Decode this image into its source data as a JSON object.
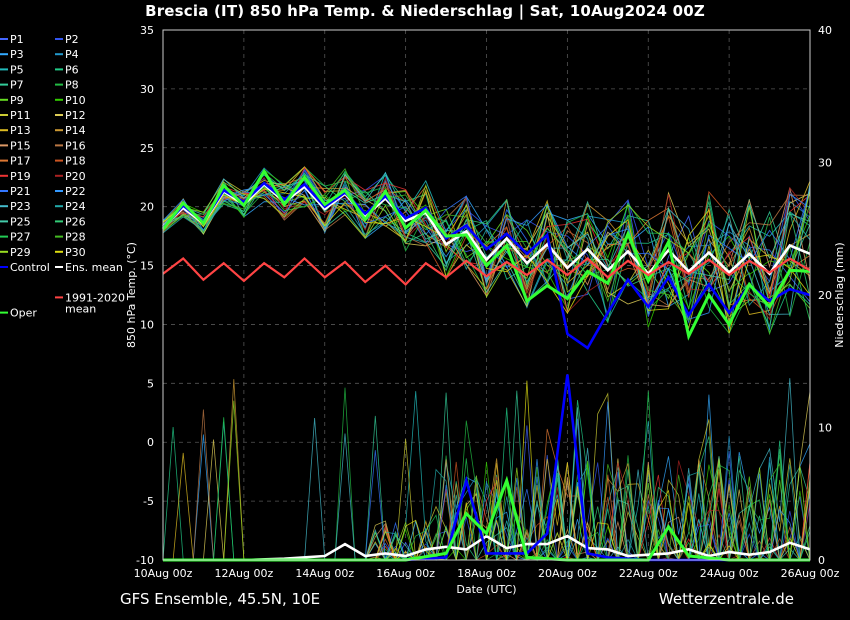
{
  "title": "Brescia  (IT)  850 hPa Temp. & Niederschlag | Sat, 10Aug2024 00Z",
  "footer_left": "GFS Ensemble, 45.5N, 10E",
  "footer_right": "Wetterzentrale.de",
  "chart_data": {
    "type": "line",
    "xlabel": "Date (UTC)",
    "ylabel_left": "850 hPa Temp. (°C)",
    "ylabel_right": "Niederschlag (mm)",
    "x_ticks": [
      "10Aug 00z",
      "12Aug 00z",
      "14Aug 00z",
      "16Aug 00z",
      "18Aug 00z",
      "20Aug 00z",
      "22Aug 00z",
      "24Aug 00z",
      "26Aug 00z"
    ],
    "xlim_days": [
      0,
      16
    ],
    "ylim_left": [
      -10,
      35
    ],
    "yticks_left": [
      -10,
      -5,
      0,
      5,
      10,
      15,
      20,
      25,
      30,
      35
    ],
    "ylim_right": [
      0,
      40
    ],
    "yticks_right": [
      0,
      10,
      20,
      30,
      40
    ],
    "grid": true,
    "legend_placement": "left",
    "legend": [
      {
        "label": "P1",
        "color": "#4466ff"
      },
      {
        "label": "P2",
        "color": "#3355ee"
      },
      {
        "label": "P3",
        "color": "#33aaff"
      },
      {
        "label": "P4",
        "color": "#2299cc"
      },
      {
        "label": "P5",
        "color": "#22bbbb"
      },
      {
        "label": "P6",
        "color": "#22cc88"
      },
      {
        "label": "P7",
        "color": "#33cc99"
      },
      {
        "label": "P8",
        "color": "#22bb44"
      },
      {
        "label": "P9",
        "color": "#66dd22"
      },
      {
        "label": "P10",
        "color": "#33cc00"
      },
      {
        "label": "P11",
        "color": "#cccc33"
      },
      {
        "label": "P12",
        "color": "#ddcc55"
      },
      {
        "label": "P13",
        "color": "#ddbb22"
      },
      {
        "label": "P14",
        "color": "#cc9933"
      },
      {
        "label": "P15",
        "color": "#dd9966"
      },
      {
        "label": "P16",
        "color": "#bb7744"
      },
      {
        "label": "P17",
        "color": "#dd7733"
      },
      {
        "label": "P18",
        "color": "#cc5522"
      },
      {
        "label": "P19",
        "color": "#ee3333"
      },
      {
        "label": "P20",
        "color": "#aa2222"
      },
      {
        "label": "P21",
        "color": "#3377ff"
      },
      {
        "label": "P22",
        "color": "#3399ff"
      },
      {
        "label": "P23",
        "color": "#44bbcc"
      },
      {
        "label": "P24",
        "color": "#22aaaa"
      },
      {
        "label": "P25",
        "color": "#44ccaa"
      },
      {
        "label": "P26",
        "color": "#33cc77"
      },
      {
        "label": "P27",
        "color": "#22cc55"
      },
      {
        "label": "P28",
        "color": "#44bb22"
      },
      {
        "label": "P29",
        "color": "#99dd22"
      },
      {
        "label": "P30",
        "color": "#dddd11"
      },
      {
        "label": "Control",
        "color": "#0000ff"
      },
      {
        "label": "Ens. mean",
        "color": "#ffffff"
      },
      {
        "label": "1991-2020 mean",
        "color": "#ff4444"
      },
      {
        "label": "Oper",
        "color": "#33ff33"
      }
    ],
    "series_temp": [
      {
        "name": "Ens. mean",
        "color": "#ffffff",
        "x": [
          0,
          0.5,
          1,
          1.5,
          2,
          2.5,
          3,
          3.5,
          4,
          4.5,
          5,
          5.5,
          6,
          6.5,
          7,
          7.5,
          8,
          8.5,
          9,
          9.5,
          10,
          10.5,
          11,
          11.5,
          12,
          12.5,
          13,
          13.5,
          14,
          14.5,
          15,
          15.5,
          16
        ],
        "y": [
          18.3,
          19.9,
          18.6,
          21.3,
          20.2,
          21.9,
          20.4,
          21.7,
          19.8,
          21.1,
          19.2,
          20.7,
          18.8,
          19.5,
          16.8,
          17.9,
          15.5,
          17.3,
          15.2,
          16.8,
          14.8,
          16.4,
          14.6,
          16.2,
          14.3,
          16.3,
          14.5,
          16.1,
          14.4,
          16.0,
          14.3,
          16.7,
          16.0
        ]
      },
      {
        "name": "Control",
        "color": "#0000ff",
        "x": [
          0,
          0.5,
          1,
          1.5,
          2,
          2.5,
          3,
          3.5,
          4,
          4.5,
          5,
          5.5,
          6,
          6.5,
          7,
          7.5,
          8,
          8.5,
          9,
          9.5,
          10,
          10.5,
          11,
          11.5,
          12,
          12.5,
          13,
          13.5,
          14,
          14.5,
          15,
          15.5,
          16
        ],
        "y": [
          18.2,
          20.1,
          18.7,
          21.4,
          20.4,
          22.0,
          20.6,
          21.9,
          20.0,
          21.2,
          19.4,
          20.9,
          19.0,
          19.9,
          17.3,
          18.4,
          16.4,
          17.7,
          16.0,
          17.6,
          9.2,
          8.0,
          11.0,
          13.8,
          11.5,
          14.0,
          10.8,
          13.4,
          11.0,
          13.3,
          12.0,
          13.0,
          12.5
        ]
      },
      {
        "name": "Oper",
        "color": "#33ff33",
        "x": [
          0,
          0.5,
          1,
          1.5,
          2,
          2.5,
          3,
          3.5,
          4,
          4.5,
          5,
          5.5,
          6,
          6.5,
          7,
          7.5,
          8,
          8.5,
          9,
          9.5,
          10,
          10.5,
          11,
          11.5,
          12,
          12.5,
          13,
          13.5,
          14,
          14.5,
          15,
          15.5,
          16
        ],
        "y": [
          18.1,
          20.3,
          18.6,
          21.8,
          20.1,
          23.0,
          20.2,
          22.5,
          20.2,
          21.4,
          18.9,
          21.3,
          18.2,
          19.7,
          17.5,
          17.6,
          15.0,
          16.7,
          12.0,
          13.3,
          12.2,
          14.5,
          13.5,
          17.7,
          13.7,
          17.0,
          9.0,
          12.5,
          10.0,
          13.4,
          11.5,
          14.6,
          14.5
        ]
      },
      {
        "name": "1991-2020 mean",
        "color": "#ff4444",
        "x": [
          0,
          0.5,
          1,
          1.5,
          2,
          2.5,
          3,
          3.5,
          4,
          4.5,
          5,
          5.5,
          6,
          6.5,
          7,
          7.5,
          8,
          8.5,
          9,
          9.5,
          10,
          10.5,
          11,
          11.5,
          12,
          12.5,
          13,
          13.5,
          14,
          14.5,
          15,
          15.5,
          16
        ],
        "y": [
          14.3,
          15.6,
          13.8,
          15.2,
          13.7,
          15.2,
          14.0,
          15.6,
          14.0,
          15.3,
          13.6,
          15.0,
          13.4,
          15.2,
          14.0,
          15.4,
          14.1,
          15.3,
          14.2,
          15.5,
          14.2,
          15.6,
          14.0,
          15.4,
          14.2,
          15.3,
          14.3,
          15.5,
          14.2,
          15.4,
          14.4,
          15.6,
          14.6
        ]
      }
    ],
    "series_precip": [
      {
        "name": "Ens. mean",
        "color": "#ffffff",
        "x": [
          0,
          1,
          2,
          3,
          4,
          4.5,
          5,
          5.5,
          6,
          6.5,
          7,
          7.5,
          8,
          8.5,
          9,
          9.5,
          10,
          10.5,
          11,
          11.5,
          12,
          12.5,
          13,
          13.5,
          14,
          14.5,
          15,
          15.5,
          16
        ],
        "y": [
          0,
          0,
          0,
          0.1,
          0.3,
          1.2,
          0.3,
          0.5,
          0.3,
          0.8,
          1.0,
          0.8,
          1.8,
          0.9,
          1.2,
          1.2,
          1.8,
          0.9,
          0.8,
          0.3,
          0.4,
          0.5,
          0.8,
          0.3,
          0.6,
          0.4,
          0.6,
          1.3,
          0.8
        ]
      },
      {
        "name": "Control",
        "color": "#0000ff",
        "x": [
          0,
          2,
          4,
          6,
          7,
          7.5,
          8,
          9,
          9.5,
          10,
          10.5,
          11,
          12,
          14,
          16
        ],
        "y": [
          0,
          0,
          0,
          0,
          0.2,
          6.0,
          0.5,
          0.5,
          2.0,
          14.0,
          0.5,
          0.2,
          0,
          0,
          0
        ]
      },
      {
        "name": "Oper",
        "color": "#33ff33",
        "x": [
          0,
          2,
          4,
          6,
          7,
          7.5,
          8,
          8.5,
          9,
          10,
          11,
          12,
          12.5,
          13,
          14,
          15,
          16
        ],
        "y": [
          0,
          0,
          0,
          0,
          0.5,
          3.5,
          2.0,
          6.0,
          0.2,
          0,
          0,
          0,
          2.5,
          0.3,
          0,
          0,
          0
        ]
      }
    ]
  }
}
